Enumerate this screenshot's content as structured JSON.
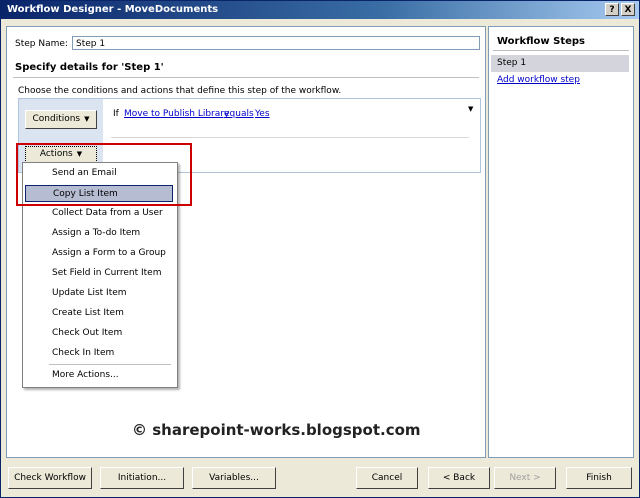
{
  "window": {
    "title": "Workflow Designer - MoveDocuments",
    "help_btn": "?",
    "close_btn": "X"
  },
  "step": {
    "name_label": "Step Name:",
    "name_value": "Step 1",
    "details_heading": "Specify details for 'Step 1'",
    "instructions": "Choose the conditions and actions that define this step of the workflow."
  },
  "rule": {
    "conditions_btn": "Conditions",
    "actions_btn": "Actions",
    "if_word": "If",
    "field": "Move to Publish Library",
    "operator": "equals",
    "value": "Yes",
    "dropdown_arrow": "▼"
  },
  "actions_menu": {
    "items": [
      "Send an Email",
      "Copy List Item",
      "Collect Data from a User",
      "Assign a To-do Item",
      "Assign a Form to a Group",
      "Set Field in Current Item",
      "Update List Item",
      "Create List Item",
      "Check Out Item",
      "Check In Item"
    ],
    "more": "More Actions...",
    "selected": "Copy List Item"
  },
  "sidebar": {
    "title": "Workflow Steps",
    "step_item": "Step 1",
    "add_link": "Add workflow step"
  },
  "watermark": "© sharepoint-works.blogspot.com",
  "footer": {
    "check": "Check Workflow",
    "initiation": "Initiation...",
    "variables": "Variables...",
    "cancel": "Cancel",
    "back": "< Back",
    "next": "Next >",
    "finish": "Finish"
  },
  "colors": {
    "titlebar": "#0a246a",
    "highlight": "#cc0000",
    "link": "#0000cc"
  }
}
